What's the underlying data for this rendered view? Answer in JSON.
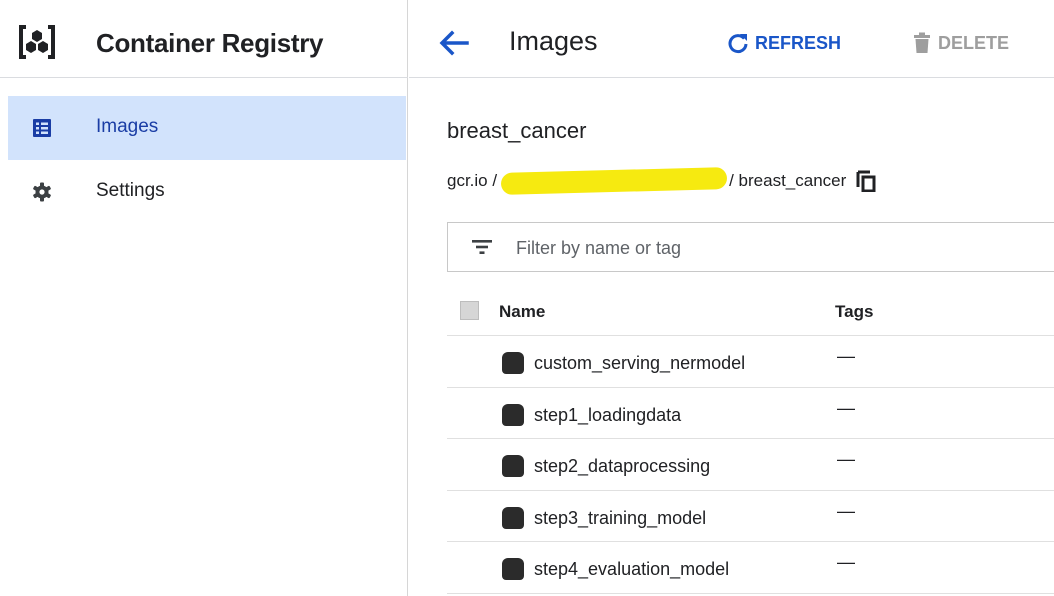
{
  "app": {
    "title": "Container Registry",
    "logo_icon": "container-registry-hexagon-icon"
  },
  "sidebar": {
    "items": [
      {
        "label": "Images",
        "icon": "list-icon",
        "active": true
      },
      {
        "label": "Settings",
        "icon": "gear-icon",
        "active": false
      }
    ]
  },
  "header": {
    "back_icon": "arrow-left-icon",
    "title": "Images",
    "refresh_label": "REFRESH",
    "delete_label": "DELETE"
  },
  "repository": {
    "name": "breast_cancer",
    "path_prefix": "gcr.io /",
    "path_suffix": "/ breast_cancer",
    "copy_icon": "copy-icon"
  },
  "filter": {
    "placeholder": "Filter by name or tag",
    "value": ""
  },
  "table": {
    "columns": [
      "Name",
      "Tags"
    ],
    "rows": [
      {
        "name": "custom_serving_nermodel",
        "tags": "—"
      },
      {
        "name": "step1_loadingdata",
        "tags": "—"
      },
      {
        "name": "step2_dataprocessing",
        "tags": "—"
      },
      {
        "name": "step3_training_model",
        "tags": "—"
      },
      {
        "name": "step4_evaluation_model",
        "tags": "—"
      }
    ]
  },
  "colors": {
    "accent": "#1a56c8",
    "nav_active_bg": "#d2e3fc",
    "nav_active_text": "#1a3da5",
    "disabled": "#9e9e9e",
    "redaction": "#f6ea10"
  }
}
